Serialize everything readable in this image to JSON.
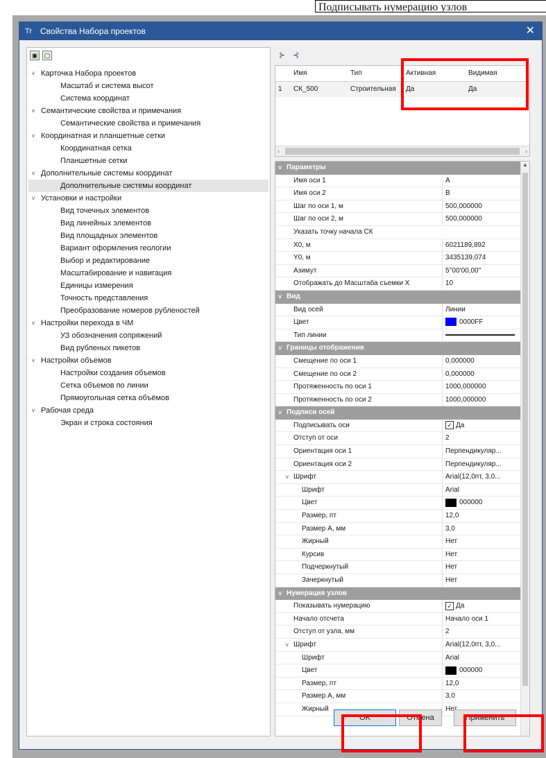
{
  "top_note": "Подписывать нумерацию узлов",
  "window": {
    "title": "Свойства Набора проектов",
    "app_icon": "app-logo-icon",
    "close_glyph": "✕"
  },
  "tree": [
    {
      "label": "Карточка Набора проектов",
      "level": 0,
      "expanded": true
    },
    {
      "label": "Масштаб и система высот",
      "level": 1
    },
    {
      "label": "Система координат",
      "level": 1
    },
    {
      "label": "Семантические свойства и примечания",
      "level": 0,
      "expanded": true
    },
    {
      "label": "Семантические свойства и примечания",
      "level": 1
    },
    {
      "label": "Координатная и планшетные сетки",
      "level": 0,
      "expanded": true
    },
    {
      "label": "Координатная сетка",
      "level": 1
    },
    {
      "label": "Планшетные сетки",
      "level": 1
    },
    {
      "label": "Дополнительные системы координат",
      "level": 0,
      "expanded": true
    },
    {
      "label": "Дополнительные системы координат",
      "level": 1,
      "selected": true
    },
    {
      "label": "Установки и настройки",
      "level": 0,
      "expanded": true
    },
    {
      "label": "Вид точечных элементов",
      "level": 1
    },
    {
      "label": "Вид линейных элементов",
      "level": 1
    },
    {
      "label": "Вид площадных элементов",
      "level": 1
    },
    {
      "label": "Вариант оформления геологии",
      "level": 1
    },
    {
      "label": "Выбор и редактирование",
      "level": 1
    },
    {
      "label": "Масштабирование и навигация",
      "level": 1
    },
    {
      "label": "Единицы измерения",
      "level": 1
    },
    {
      "label": "Точность представления",
      "level": 1
    },
    {
      "label": "Преобразование номеров рубленостей",
      "level": 1
    },
    {
      "label": "Настройки перехода в ЧМ",
      "level": 0,
      "expanded": true
    },
    {
      "label": "УЗ обозначения сопряжений",
      "level": 1
    },
    {
      "label": "Вид рубленых пикетов",
      "level": 1
    },
    {
      "label": "Настройки объемов",
      "level": 0,
      "expanded": true
    },
    {
      "label": "Настройки создания объемов",
      "level": 1
    },
    {
      "label": "Сетка объемов по линии",
      "level": 1
    },
    {
      "label": "Прямоугольная сетка объёмов",
      "level": 1
    },
    {
      "label": "Рабочая среда",
      "level": 0,
      "expanded": true
    },
    {
      "label": "Экран и строка состояния",
      "level": 1
    }
  ],
  "grid": {
    "columns": [
      "Имя",
      "Тип",
      "Активная",
      "Видимая"
    ],
    "rows": [
      {
        "num": "1",
        "name": "СК_500",
        "type": "Строительная",
        "active": "Да",
        "visible": "Да"
      }
    ]
  },
  "props": [
    {
      "kind": "section",
      "label": "Параметры"
    },
    {
      "name": "Имя оси 1",
      "value": "A"
    },
    {
      "name": "Имя оси 2",
      "value": "B"
    },
    {
      "name": "Шаг по оси 1, м",
      "value": "500,000000"
    },
    {
      "name": "Шаг по оси 2, м",
      "value": "500,000000"
    },
    {
      "name": "Указать точку начала СК",
      "value": ""
    },
    {
      "name": "X0, м",
      "value": "6021189,892"
    },
    {
      "name": "Y0, м",
      "value": "3435139,074"
    },
    {
      "name": "Азимут",
      "value": "5°00'00,00\""
    },
    {
      "name": "Отображать до Масштаба съемки X",
      "value": "10"
    },
    {
      "kind": "section",
      "label": "Вид"
    },
    {
      "name": "Вид осей",
      "value": "Линии"
    },
    {
      "name": "Цвет",
      "value": "0000FF",
      "swatch": "#0000ff"
    },
    {
      "name": "Тип линии",
      "value": "",
      "line": true
    },
    {
      "kind": "section",
      "label": "Границы отображения"
    },
    {
      "name": "Смещение по оси 1",
      "value": "0,000000"
    },
    {
      "name": "Смещение по оси 2",
      "value": "0,000000"
    },
    {
      "name": "Протяженность по оси 1",
      "value": "1000,000000"
    },
    {
      "name": "Протяженность по оси 2",
      "value": "1000,000000"
    },
    {
      "kind": "section",
      "label": "Подписи осей"
    },
    {
      "name": "Подписывать оси",
      "value": "Да",
      "check": true
    },
    {
      "name": "Отступ от оси",
      "value": "2"
    },
    {
      "name": "Ориентация оси 1",
      "value": "Перпендикуляр..."
    },
    {
      "name": "Ориентация оси 2",
      "value": "Перпендикуляр..."
    },
    {
      "name": "Шрифт",
      "value": "Arial(12,0пт, 3,0...",
      "expander": true
    },
    {
      "name": "Шрифт",
      "value": "Arial",
      "l2": true
    },
    {
      "name": "Цвет",
      "value": "000000",
      "swatch": "#000000",
      "l2": true
    },
    {
      "name": "Размер, пт",
      "value": "12,0",
      "l2": true
    },
    {
      "name": "Размер А, мм",
      "value": "3,0",
      "l2": true
    },
    {
      "name": "Жирный",
      "value": "Нет",
      "l2": true
    },
    {
      "name": "Курсив",
      "value": "Нет",
      "l2": true
    },
    {
      "name": "Подчеркнутый",
      "value": "Нет",
      "l2": true
    },
    {
      "name": "Зачеркнутый",
      "value": "Нет",
      "l2": true
    },
    {
      "kind": "section",
      "label": "Нумерация узлов"
    },
    {
      "name": "Показывать нумерацию",
      "value": "Да",
      "check": true
    },
    {
      "name": "Начало отсчета",
      "value": "Начало оси 1"
    },
    {
      "name": "Отступ от узла, мм",
      "value": "2"
    },
    {
      "name": "Шрифт",
      "value": "Arial(12,0пт, 3,0...",
      "expander": true
    },
    {
      "name": "Шрифт",
      "value": "Arial",
      "l2": true
    },
    {
      "name": "Цвет",
      "value": "000000",
      "swatch": "#000000",
      "l2": true
    },
    {
      "name": "Размер, пт",
      "value": "12,0",
      "l2": true
    },
    {
      "name": "Размер А, мм",
      "value": "3,0",
      "l2": true
    },
    {
      "name": "Жирный",
      "value": "Нет",
      "l2": true
    }
  ],
  "buttons": {
    "ok": "OK",
    "cancel": "Отмена",
    "apply": "Применить"
  },
  "colors": {
    "title_bar": "#2b5797",
    "highlight": "#ff0000",
    "section": "#9e9e9e"
  }
}
